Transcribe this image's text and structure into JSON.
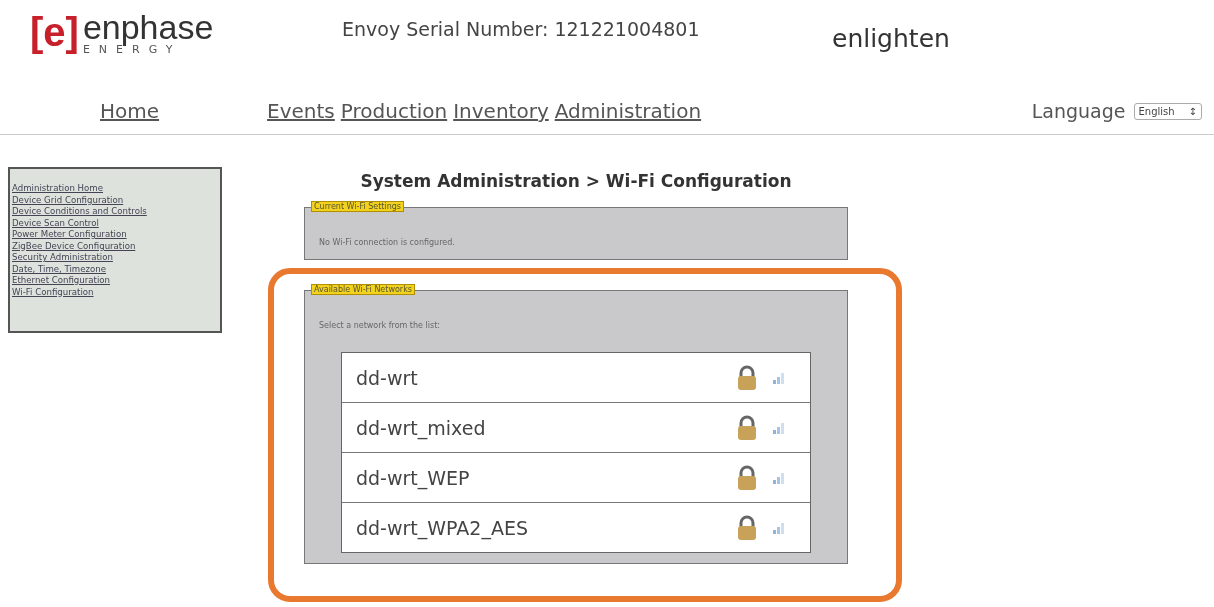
{
  "header": {
    "logo_mark": "[e]",
    "logo_name": "enphase",
    "logo_sub": "ENERGY",
    "serial": "Envoy Serial Number: 121221004801",
    "brand": "enlighten"
  },
  "nav": {
    "items": [
      {
        "label": "Home"
      },
      {
        "label": "Events"
      },
      {
        "label": "Production"
      },
      {
        "label": "Inventory"
      },
      {
        "label": "Administration"
      }
    ],
    "language_label": "Language",
    "language_value": "English",
    "language_arrow": "↕"
  },
  "sidebar": {
    "items": [
      {
        "label": "Administration Home"
      },
      {
        "label": "Device Grid Configuration"
      },
      {
        "label": "Device Conditions and Controls"
      },
      {
        "label": "Device Scan Control"
      },
      {
        "label": "Power Meter Configuration"
      },
      {
        "label": "ZigBee Device Configuration"
      },
      {
        "label": "Security Administration"
      },
      {
        "label": "Date, Time, Timezone"
      },
      {
        "label": "Ethernet Configuration"
      },
      {
        "label": "Wi-Fi Configuration"
      }
    ]
  },
  "page_title": "System Administration > Wi-Fi Configuration",
  "current": {
    "legend": "Current Wi-Fi Settings",
    "text": "No Wi-Fi connection is configured."
  },
  "available": {
    "legend": "Available Wi-Fi Networks",
    "text": "Select a network from the list:",
    "networks": [
      {
        "name": "dd-wrt",
        "secured": true
      },
      {
        "name": "dd-wrt_mixed",
        "secured": true
      },
      {
        "name": "dd-wrt_WEP",
        "secured": true
      },
      {
        "name": "dd-wrt_WPA2_AES",
        "secured": true
      }
    ]
  }
}
